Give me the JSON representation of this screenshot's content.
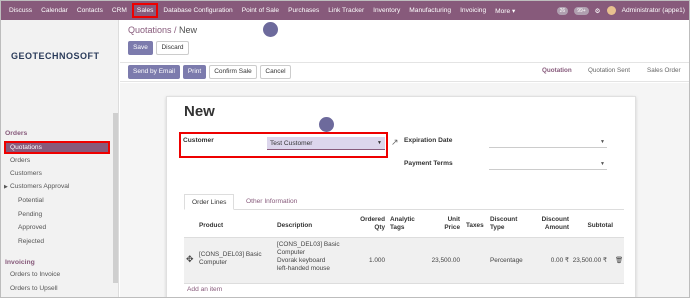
{
  "topnav": {
    "menu": [
      "Discuss",
      "Calendar",
      "Contacts",
      "CRM",
      "Sales",
      "Database Configuration",
      "Point of Sale",
      "Purchases",
      "Link Tracker",
      "Inventory",
      "Manufacturing",
      "Invoicing",
      "More ▾"
    ],
    "active": "Sales",
    "badge1": "26",
    "badge2": "99+",
    "user": "Administrator (appe1)"
  },
  "sidebar": {
    "logo": "GEOTECHNOSOFT",
    "orders_section": "Orders",
    "items": [
      "Quotations",
      "Orders",
      "Customers",
      "Customers Approval"
    ],
    "approval_sub": [
      "Potential",
      "Pending",
      "Approved",
      "Rejected"
    ],
    "invoicing_section": "Invoicing",
    "invoicing_items": [
      "Orders to Invoice",
      "Orders to Upsell"
    ]
  },
  "breadcrumb": {
    "parent": "Quotations",
    "sep": " / ",
    "current": "New"
  },
  "buttons": {
    "save": "Save",
    "discard": "Discard",
    "send_email": "Send by Email",
    "print": "Print",
    "confirm": "Confirm Sale",
    "cancel": "Cancel"
  },
  "stages": [
    "Quotation",
    "Quotation Sent",
    "Sales Order"
  ],
  "form": {
    "title": "New",
    "customer_label": "Customer",
    "customer_value": "Test Customer",
    "expiration_label": "Expiration Date",
    "payment_terms_label": "Payment Terms"
  },
  "tabs": [
    "Order Lines",
    "Other Information"
  ],
  "table": {
    "headers": {
      "product": "Product",
      "description": "Description",
      "ordered_qty": [
        "Ordered",
        "Qty"
      ],
      "analytic": [
        "Analytic",
        "Tags"
      ],
      "unit_price": [
        "Unit",
        "Price"
      ],
      "taxes": "Taxes",
      "discount_type": [
        "Discount",
        "Type"
      ],
      "discount_amount": [
        "Discount",
        "Amount"
      ],
      "subtotal": "Subtotal"
    },
    "row": {
      "product": [
        "[CONS_DEL03] Basic",
        "Computer"
      ],
      "description": [
        "[CONS_DEL03] Basic",
        "Computer",
        "Dvorak keyboard",
        "left-handed mouse"
      ],
      "qty": "1.000",
      "unit_price": "23,500.00",
      "discount_type": "Percentage",
      "discount_amount": "0.00 ₹",
      "subtotal": "23,500.00 ₹"
    },
    "add_item": "Add an item"
  },
  "colors": {
    "brand": "#875a7b",
    "primary_button": "#7c7bad",
    "highlight": "#ee0000"
  }
}
